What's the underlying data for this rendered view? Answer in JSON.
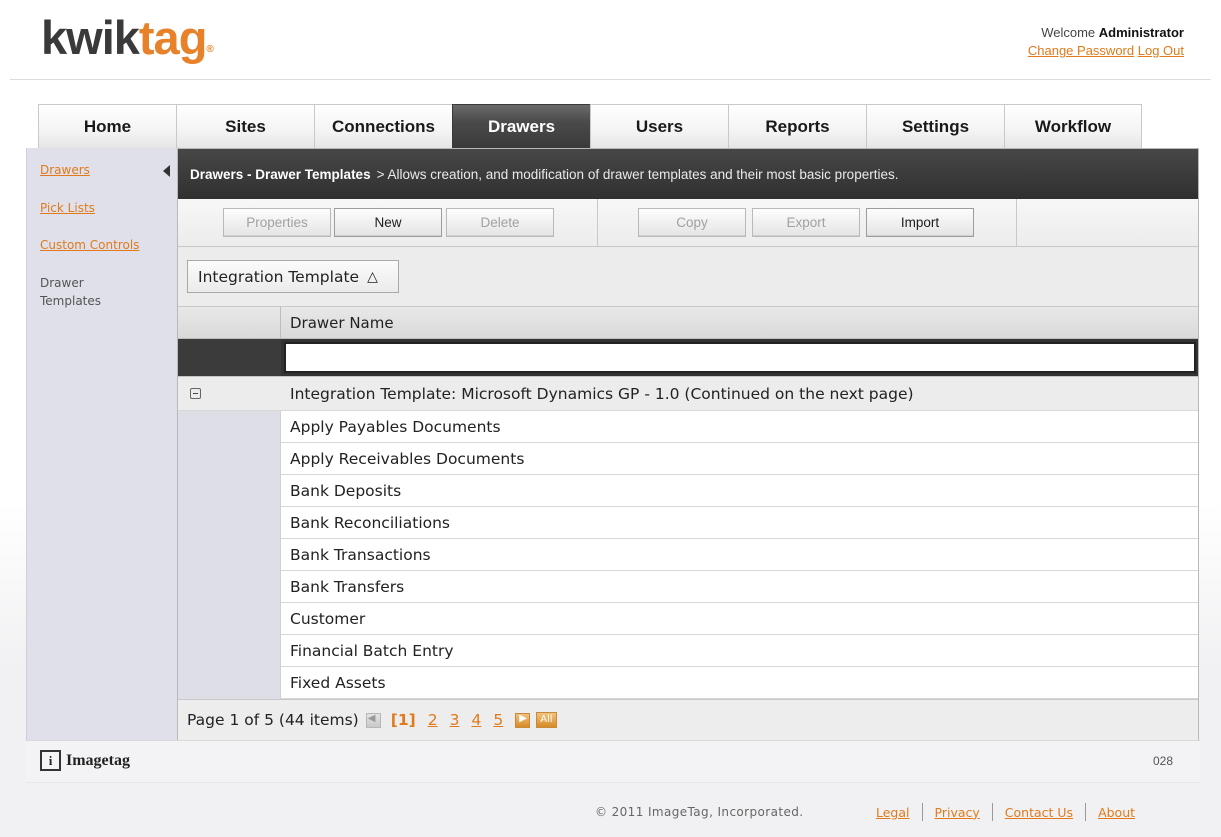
{
  "header": {
    "logo_part1": "kwik",
    "logo_part2": "tag",
    "logo_mark": "®",
    "welcome_prefix": "Welcome",
    "username": "Administrator",
    "change_password": "Change Password",
    "logout": "Log Out"
  },
  "tabs": [
    {
      "label": "Home",
      "active": false
    },
    {
      "label": "Sites",
      "active": false
    },
    {
      "label": "Connections",
      "active": false
    },
    {
      "label": "Drawers",
      "active": true
    },
    {
      "label": "Users",
      "active": false
    },
    {
      "label": "Reports",
      "active": false
    },
    {
      "label": "Settings",
      "active": false
    },
    {
      "label": "Workflow",
      "active": false
    }
  ],
  "sidebar": {
    "items": [
      {
        "label": "Drawers",
        "link": true
      },
      {
        "label": "Pick Lists",
        "link": true
      },
      {
        "label": "Custom Controls",
        "link": true
      },
      {
        "label": "Drawer Templates",
        "link": false
      }
    ]
  },
  "main": {
    "title_bold": "Drawers - Drawer Templates",
    "title_desc": "> Allows creation, and modification of drawer templates and their most basic properties.",
    "toolbar": {
      "properties": "Properties",
      "new": "New",
      "delete": "Delete",
      "copy": "Copy",
      "export": "Export",
      "import": "Import"
    },
    "group_chip": "Integration Template",
    "group_chip_sort": "△",
    "grid": {
      "column": "Drawer Name",
      "filter_value": "",
      "group_label": "Integration Template: Microsoft Dynamics GP - 1.0 (Continued on the next page)",
      "rows": [
        "Apply Payables Documents",
        "Apply Receivables Documents",
        "Bank Deposits",
        "Bank Reconciliations",
        "Bank Transactions",
        "Bank Transfers",
        "Customer",
        "Financial Batch Entry",
        "Fixed Assets"
      ]
    },
    "pager": {
      "summary": "Page 1 of 5 (44 items)",
      "current": "[1]",
      "pages": [
        "2",
        "3",
        "4",
        "5"
      ],
      "all": "All"
    }
  },
  "footer": {
    "brand": "Imagetag",
    "brand_box": "i",
    "code": "028",
    "copyright": "© 2011 ImageTag, Incorporated.",
    "links": [
      "Legal",
      "Privacy",
      "Contact Us",
      "About"
    ]
  },
  "colors": {
    "brand_orange": "#e8822a",
    "link_orange": "#e07a1b",
    "active_tab": "#3a3a3a",
    "sidebar_bg": "#dfe0ea"
  },
  "icons": {
    "collapse": "chevron-left-icon",
    "expander": "collapse-minus-icon",
    "first_page": "first-page-icon",
    "next_page": "next-page-icon"
  }
}
